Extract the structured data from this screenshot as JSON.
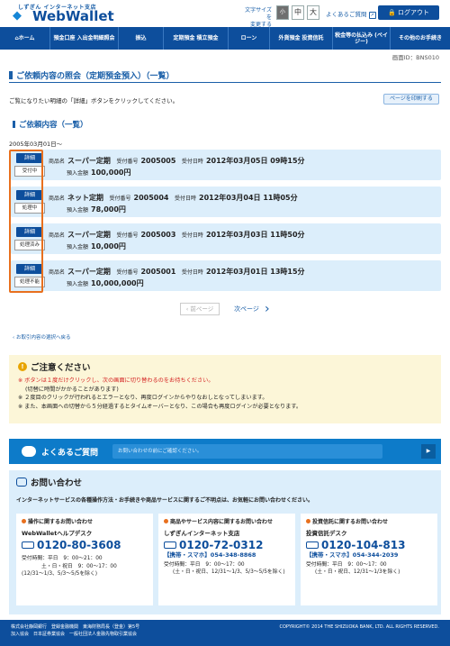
{
  "header": {
    "logo_sub": "しずぎん インターネット支店",
    "logo": "WebWallet",
    "font_size_label_1": "文字サイズを",
    "font_size_label_2": "変更する",
    "font_sizes": [
      "小",
      "中",
      "大"
    ],
    "faq_link": "よくあるご質問",
    "logout": "ログアウト"
  },
  "nav": [
    "ホーム",
    "預金口座 入出金明細照会",
    "振込",
    "定期預金 積立預金",
    "ローン",
    "外貨預金 投資信託",
    "税金等の払込み (ペイジー)",
    "その他のお手続き"
  ],
  "screen_id": "画面ID：BNS010",
  "page_title": "ご依頼内容の照会（定期預金預入）（一覧）",
  "description": "ご覧になりたい明細の「詳細」ボタンをクリックしてください。",
  "print_button": "ページを印刷する",
  "list_title": "ご依頼内容（一覧）",
  "date_since": "2005年03月01日～",
  "labels": {
    "product": "商品名",
    "receipt_no": "受付番号",
    "receipt_time": "受付日時",
    "amount": "預入金額",
    "detail": "詳細"
  },
  "rows": [
    {
      "status": "受付中",
      "product": "スーパー定期",
      "no": "2005005",
      "datetime": "2012年03月05日 09時15分",
      "amount": "100,000円"
    },
    {
      "status": "処理中",
      "product": "ネット定期",
      "no": "2005004",
      "datetime": "2012年03月04日 11時05分",
      "amount": "78,000円"
    },
    {
      "status": "処理済み",
      "product": "スーパー定期",
      "no": "2005003",
      "datetime": "2012年03月03日 11時50分",
      "amount": "10,000円"
    },
    {
      "status": "処理不能",
      "product": "スーパー定期",
      "no": "2005001",
      "datetime": "2012年03月01日 13時15分",
      "amount": "10,000,000円"
    }
  ],
  "pager": {
    "prev": "前ページ",
    "next": "次ページ"
  },
  "back_link": "お取引内容の選択へ戻る",
  "notice": {
    "title": "ご注意ください",
    "line1": "※ ボタンは１度だけクリックし、次の画面に切り替わるのをお待ちください。",
    "line1b": "(切替に時間がかかることがあります)",
    "line2": "※ ２度目のクリックが行われるとエラーとなり、再度ログインからやりなおしとなってしまいます。",
    "line3": "※ また、本画面への切替から５分経過するとタイムオーバーとなり、この場合も再度ログインが必要となります。"
  },
  "faq": {
    "title": "よくあるご質問",
    "placeholder": "お問い合わせの前にご確認ください。"
  },
  "contact": {
    "title": "お問い合わせ",
    "description": "インターネットサービスの各種操作方法・お手続きや商品サービスに関するご不明点は、お気軽にお問い合わせください。",
    "cards": [
      {
        "heading": "操作に関するお問い合わせ",
        "desk": "WebWalletヘルプデスク",
        "number": "0120-80-3608",
        "mobile": "",
        "hours1": "受付時間：平日　9：00～21：00",
        "hours2": "土・日・祝日　9：00～17：00",
        "hours3": "(12/31～1/3、5/3～5/5を除く)"
      },
      {
        "heading": "商品やサービス内容に関するお問い合わせ",
        "desk": "しずぎんインターネット支店",
        "number": "0120-72-0312",
        "mobile": "【携帯・スマホ】054-348-8868",
        "hours1": "受付時間：平日　9：00～17：00",
        "hours2": "(土・日・祝日、12/31～1/3、5/3～5/5を除く)",
        "hours3": ""
      },
      {
        "heading": "投資信託に関するお問い合わせ",
        "desk": "投資信託デスク",
        "number": "0120-104-813",
        "mobile": "【携帯・スマホ】054-344-2039",
        "hours1": "受付時間：平日　9：00～17：00",
        "hours2": "(土・日・祝日、12/31～1/3を除く)",
        "hours3": ""
      }
    ]
  },
  "footer": {
    "line1": "株式会社静岡銀行　登録金融機関　東海財務局長（登金）第5号",
    "line2": "加入協会　日本証券業協会　一般社団法人金融先物取引業協会",
    "copyright": "COPYRIGHT© 2014 THE SHIZUOKA BANK, LTD. ALL RIGHTS RESERVED."
  }
}
